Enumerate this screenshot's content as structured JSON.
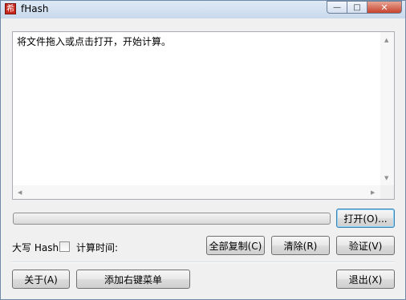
{
  "window": {
    "title": "fHash",
    "app_icon_glyph": "希",
    "minimize_glyph": "—",
    "maximize_glyph": "□",
    "close_glyph": "✕"
  },
  "output": {
    "text": "将文件拖入或点击打开，开始计算。",
    "scroll_up_glyph": "▲",
    "scroll_down_glyph": "▼",
    "scroll_left_glyph": "◀",
    "scroll_right_glyph": "▶"
  },
  "progress": {
    "value_percent": 0
  },
  "buttons": {
    "open": "打开(O)...",
    "copy_all": "全部复制(C)",
    "clear": "清除(R)",
    "verify": "验证(V)",
    "about": "关于(A)",
    "add_context_menu": "添加右键菜单",
    "exit": "退出(X)"
  },
  "options": {
    "uppercase_hash_label": "大写 Hash",
    "uppercase_hash_checked": false,
    "calc_time_label": "计算时间:"
  },
  "icons": {
    "app": "fhash-app-icon",
    "minimize": "minimize-icon",
    "maximize": "maximize-icon",
    "close": "close-icon"
  },
  "colors": {
    "titlebar": "#c9d9ec",
    "close_button": "#c7432d",
    "app_icon": "#c8281e"
  }
}
